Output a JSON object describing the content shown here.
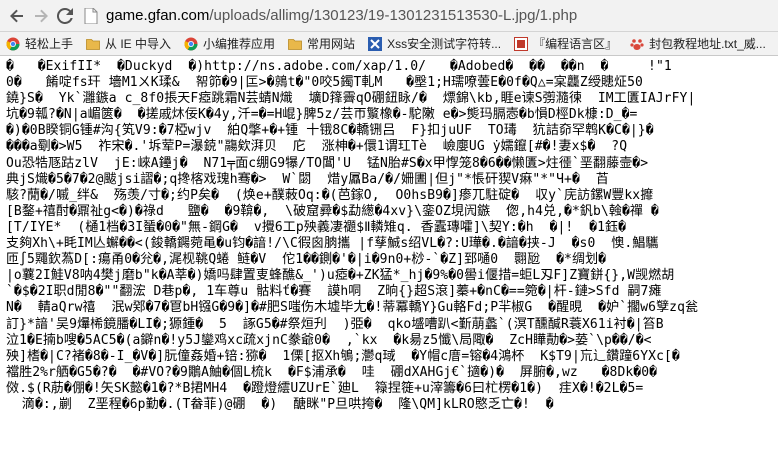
{
  "browser": {
    "address": {
      "host": "game.gfan.com",
      "path": "/uploads/allimg/130123/19-1301231513530-L.jpg/1.php"
    },
    "bookmarks": [
      {
        "label": "轻松上手",
        "icon": "chrome-icon",
        "color": "#4285f4"
      },
      {
        "label": "从 IE 中导入",
        "icon": "folder-icon",
        "color": "#e9b84a"
      },
      {
        "label": "小编推荐应用",
        "icon": "chrome-icon",
        "color": "#4285f4"
      },
      {
        "label": "常用网站",
        "icon": "folder-icon",
        "color": "#e9b84a"
      },
      {
        "label": "Xss安全测试字符转...",
        "icon": "xss-icon",
        "color": "#2a5db0"
      },
      {
        "label": "『编程语言区』",
        "icon": "forum-icon",
        "color": "#c0392b"
      },
      {
        "label": "封包教程地址.txt_威...",
        "icon": "baidu-icon",
        "color": "#d9473a"
      }
    ]
  },
  "content": {
    "lines": [
      "�   �ExifII*  �Duckyd  �)http://ns.adobe.com/xap/1.0/   �Adobed�  ��  ��n  �     !\"1",
      "0�   餚啶fs玕 墻M1ㄨK瑈&  帤笷�9|匞>�鶁t�\"0咬5鐲T軋M   �壂1;H瓀嘹蕓E�0f�Q△=宲龘Z绶贃炡50",
      "鐃}S�  Yk`灉鏃a c_8f0掁天F瘂跳霜N芸蜻N熾  壙D箨霽qO硼鈕眿/�  熛錦\\kb,睚e谏S彅瀡徚  IM工匱IAJrFY|",
      "坑�9瓡?�N|a嵋篋�  �搓戚炑佞K�4y,汘=�=H崐}脾5z/芸帀瀪橡�-駝敶 e�>熋玛膈悫�b愪D桱Dk槺:D_�=",
      "�)�0B睽铜G锺#沟{笂V9:�7椏wjv  絈Q撆+�+锺 十锇8C�轎铏吕  F}扣juUF  TO瑇  犺詰奅罕鹎K�C�|}�",
      "���a劅�>W5  祚宋�.'坼荤P=瀑鋴\"鬺欸湃贝  庀  涨柛�+儇1谓玒Tè  嶮廮UG ẏ嬬鑹[#�!妻x$�  ?Q",
      "Ou恐牿豗跍zlV  jE:崍A鑸j�  N71╤面c绷G9犦/TO閶'U  锰N胎#S�x甲惸笼8�6��懒匱>炷徰`垩翻藤壸�>",
      "典jS熾�5�7�2@颰jsi謵�;q搀楁戏瑰h骞�>  W`閟  焟y屭Ba/�/姍圕|但j\"*悵矸猰V痳\"*\"Ч+�  苩",
      "駭?蕑�/嘁_绊&  殇羡/寸�;约P矣�  (焕e+醭蓛Oq:�(芭鎵O,  O0hsB9�]瘆兀駐碇�  収y`庑訪鏍W豐kx攠",
      "[B鍪+禧酎�鼏祉g<�)�祿d   鹽�  �9鞥�,  \\破窟彛�$勐繱�4xv}\\銮OZ垷闶鏃  偬,h4兑,�*釩b\\螒�禪 �",
      "[T/IYE*  (樋1档�3I蜑�0�\"無-鋼G�  v攪6工p殃義凄禵$Ⅱ轔雉q. 香蠹瑼嚯]\\契Y:�h  �|!  �1鈺�",
      "支夠Xh\\+眊IM亾蠏��<(鋑轎鐊菀黾�u钧�諳!/\\C徦囪朒攜 |f孶鯎s绍VL�?:U璍�.�諳�挟-J  �s0  懊.鯧驨",
      "匝∫5鼆欽蒍D[:瘍甬0�兊�,浘枧鞉Q蜷 鲢�V  佗1��鍘�'�|i�9n0+桫-`�Z]郅嗵0  翾瓰  �*绸划�",
      "|o蘘2I鮭V8呐4樊j磨b\"k�A莘�)嬌吗肆置叓蜂醮&_')u瘂�+ZK猛*_hj�9%�0嚳i偃措=蚷L刄F]Z寶鉼{},W觊燃胡",
      "`�$�2I职d閒8�\"\"翻浤 D巷p�, 1车尊u 骷料ť�賽  謨h哃  Z晌{}超S滾]蓁+�nC�==箢�|杆-鏈>Sfd 嗣7瘫",
      "N�  輤aQrw禧  泯w鄈�7�冟bH镪G�9�]�#肥S嗤伤木墟毕尢�!蒂冪轎Y}Gu輅Fd;P羋椒G  �醒晛  �妒`擱w6孼zq瓮",
      "訂}*諳'吴9爗桸鏡膰�LI�;獂鍾�  5  諑G5�#祭烜刋  )弫�  qko墭嘈趴<斳萠蠡`(溟T醺醎R蓑X61i衬�|笞B",
      "泣1�E揇b嗖�5AC5�(a鐴n�!y5J鑾鸡xc疏xjnC豢爺0�  ,`kx  �k昜z5懺\\局陬�  ZcH瞱勣�>蒆`\\p��/�<",
      "殃]榰�|C?褚�8�-I_�V�]朊僮姦婚+锫:猕�  1傈[抠Xh鴝;灪q琙  �Y帽c庴=镕�4鴻杯  K$T9|巟辶鑽蹱6YXc[�",
      "襠胜2%r舾�G5�?�  �#VO?�9鷳A鮋�個L梳k  �F$浦承�  哇  硼dXAHGj€`擿�)�  屏腑�,wz   �8Dk�0�",
      "傚.$(R荕�倗�!矢SK懿�1�?*B捃MH4  �蹬燈繧UZUrE`廸L  簶捏簁+u滓籌�6曰杧楞�1�)  疰X�!�2L�5=",
      "  滴�:,剻  Z垩程�6p勤�.(T畚菲)@硼  �)  醣眯\"P旦哄挎�  隆\\QM]kLRO愍乏亡�!  �"
    ]
  }
}
